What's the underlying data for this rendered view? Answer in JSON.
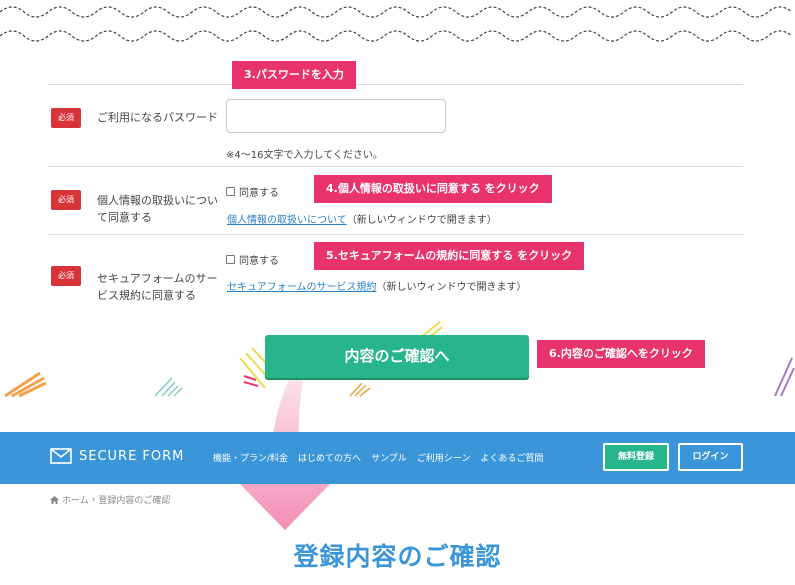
{
  "form": {
    "required_badge": "必須",
    "password": {
      "label": "ご利用になるパスワード",
      "note": "※4〜16文字で入力してください。"
    },
    "privacy": {
      "label_line1": "個人情報の取扱いについ",
      "label_line2": "て同意する",
      "checkbox_label": "同意する",
      "link_text": "個人情報の取扱いについて",
      "link_suffix": "（新しいウィンドウで開きます）"
    },
    "terms": {
      "label_line1": "セキュアフォームのサー",
      "label_line2": "ビス規約に同意する",
      "checkbox_label": "同意する",
      "link_text": "セキュアフォームのサービス規約",
      "link_suffix": "（新しいウィンドウで開きます）"
    },
    "confirm_button": "内容のご確認へ"
  },
  "callouts": {
    "step3": "3.パスワードを入力",
    "step4": "4.個人情報の取扱いに同意する をクリック",
    "step5": "5.セキュアフォームの規約に同意する をクリック",
    "step6": "6.内容のご確認へをクリック"
  },
  "header": {
    "logo_text": "SECURE FORM",
    "menu": [
      "機能・プラン/料金",
      "はじめての方へ",
      "サンプル",
      "ご利用シーン",
      "よくあるご質問"
    ],
    "register_button": "無料登録",
    "login_button": "ログイン"
  },
  "breadcrumb": {
    "home": "ホーム",
    "separator": "›",
    "current": "登録内容のご確認"
  },
  "page_title": "登録内容のご確認",
  "colors": {
    "callout": "#e8336c",
    "required": "#d8343a",
    "primary_green": "#27b58a",
    "nav_blue": "#3a96d9",
    "title_blue": "#3a96d9",
    "arrow_pink": "#f07aa6"
  },
  "icons": {
    "logo": "envelope-icon",
    "breadcrumb_home": "home-icon"
  }
}
